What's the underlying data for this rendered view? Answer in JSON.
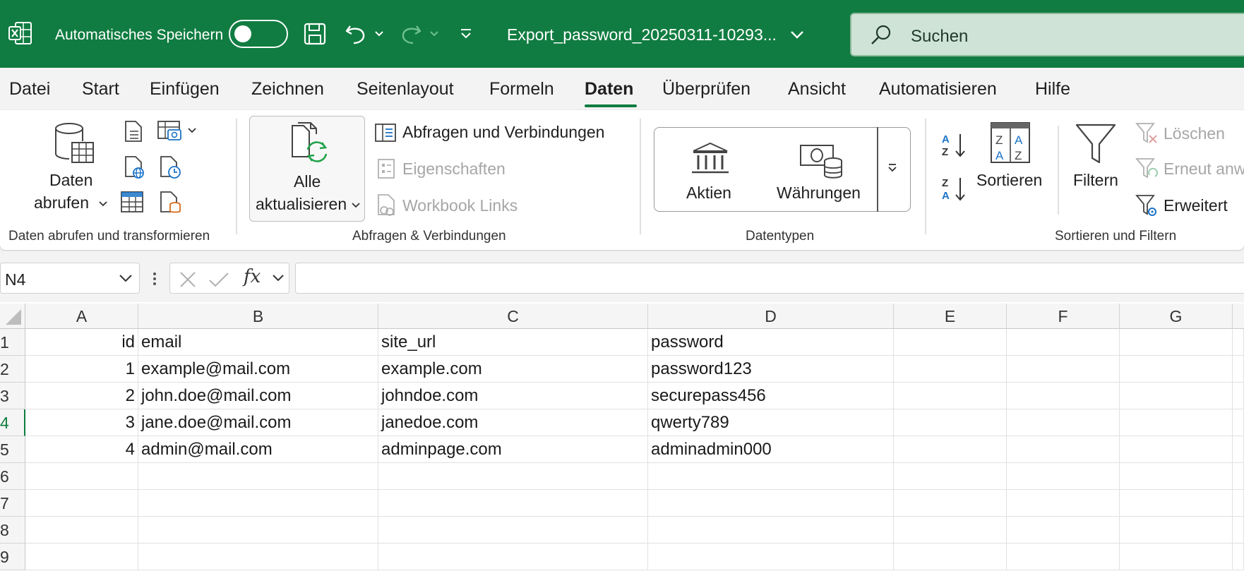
{
  "titlebar": {
    "autosave_label": "Automatisches Speichern",
    "document_title": "Export_password_20250311-10293...",
    "search_placeholder": "Suchen"
  },
  "menu": {
    "tabs": [
      "Datei",
      "Start",
      "Einfügen",
      "Zeichnen",
      "Seitenlayout",
      "Formeln",
      "Daten",
      "Überprüfen",
      "Ansicht",
      "Automatisieren",
      "Hilfe"
    ],
    "active_tab": "Daten"
  },
  "ribbon": {
    "daten_abrufen_line1": "Daten",
    "daten_abrufen_line2": "abrufen",
    "group1_label": "Daten abrufen und transformieren",
    "alle_line1": "Alle",
    "alle_line2": "aktualisieren",
    "abfragen_verbindungen": "Abfragen und Verbindungen",
    "eigenschaften": "Eigenschaften",
    "workbook_links": "Workbook Links",
    "group2_label": "Abfragen & Verbindungen",
    "aktien": "Aktien",
    "waehrungen": "Währungen",
    "group3_label": "Datentypen",
    "sortieren": "Sortieren",
    "filtern": "Filtern",
    "loeschen": "Löschen",
    "erneut": "Erneut anw",
    "erweitert": "Erweitert",
    "group4_label": "Sortieren und Filtern"
  },
  "formula_bar": {
    "name_box": "N4",
    "fx_label": "fx",
    "formula": ""
  },
  "sheet": {
    "columns": [
      "A",
      "B",
      "C",
      "D",
      "E",
      "F",
      "G"
    ],
    "row_numbers": [
      "1",
      "2",
      "3",
      "4",
      "5",
      "6",
      "7",
      "8",
      "9"
    ],
    "rows": [
      [
        "id",
        "email",
        "site_url",
        "password"
      ],
      [
        "1",
        "example@mail.com",
        "example.com",
        "password123"
      ],
      [
        "2",
        "john.doe@mail.com",
        "johndoe.com",
        "securepass456"
      ],
      [
        "3",
        "jane.doe@mail.com",
        "janedoe.com",
        "qwerty789"
      ],
      [
        "4",
        "admin@mail.com",
        "adminpage.com",
        "adminadmin000"
      ]
    ]
  },
  "colors": {
    "brand": "#107c41",
    "search_bg": "#cfe4d6"
  }
}
